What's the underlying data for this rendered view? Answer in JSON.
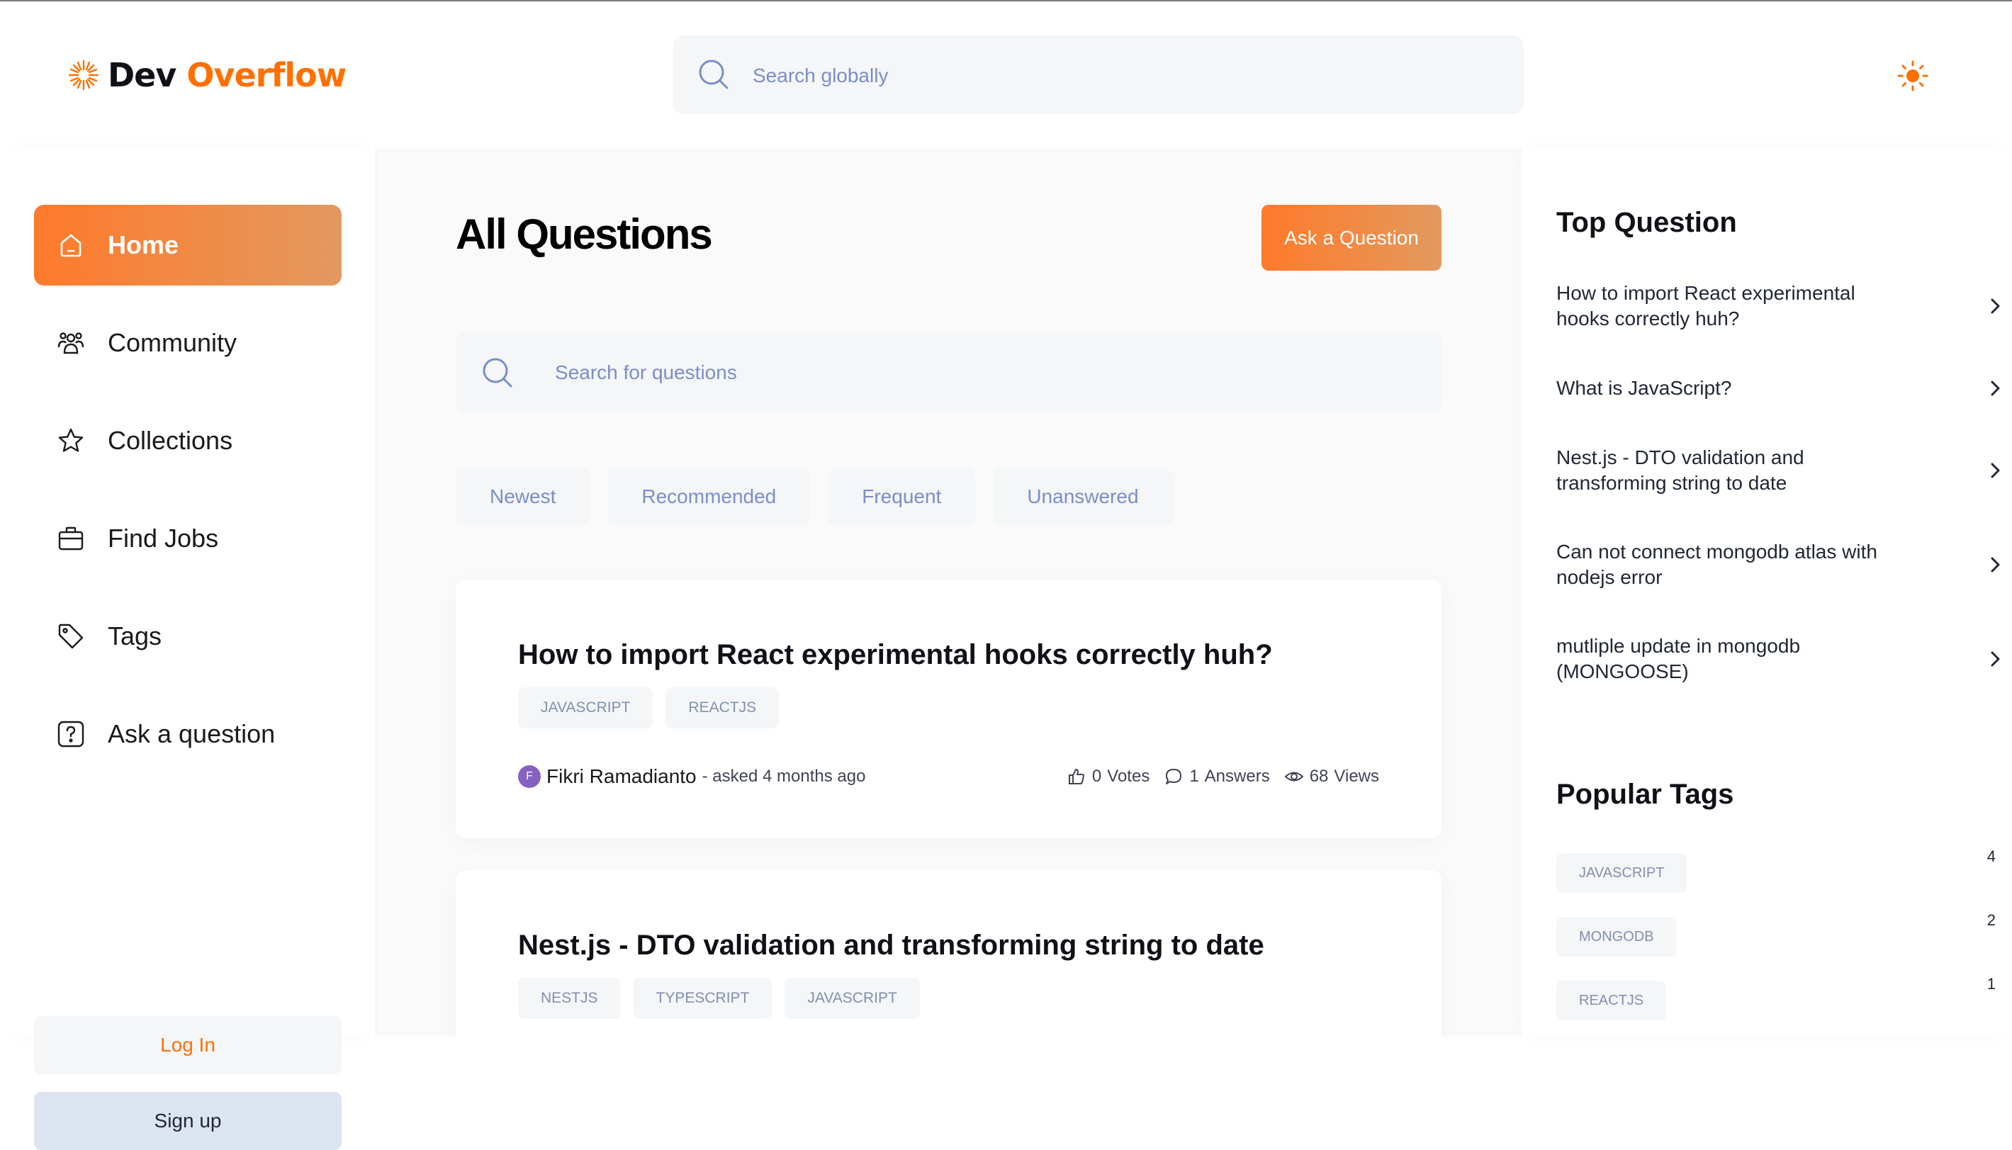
{
  "brand": {
    "part1": "Dev",
    "part2": "Overflow"
  },
  "global_search": {
    "placeholder": "Search globally"
  },
  "nav": {
    "items": [
      {
        "label": "Home",
        "icon": "home-icon"
      },
      {
        "label": "Community",
        "icon": "users-icon"
      },
      {
        "label": "Collections",
        "icon": "star-icon"
      },
      {
        "label": "Find Jobs",
        "icon": "briefcase-icon"
      },
      {
        "label": "Tags",
        "icon": "tag-icon"
      },
      {
        "label": "Ask a question",
        "icon": "question-icon"
      }
    ],
    "login_label": "Log In",
    "signup_label": "Sign up"
  },
  "main": {
    "title": "All Questions",
    "ask_button": "Ask a Question",
    "search_placeholder": "Search for questions",
    "filters": [
      "Newest",
      "Recommended",
      "Frequent",
      "Unanswered"
    ],
    "questions": [
      {
        "title": "How to import React experimental hooks correctly huh?",
        "tags": [
          "JAVASCRIPT",
          "REACTJS"
        ],
        "author_initial": "F",
        "author": "Fikri Ramadianto",
        "asked": "- asked 4 months ago",
        "votes": "0",
        "votes_label": "Votes",
        "answers": "1",
        "answers_label": "Answers",
        "views": "68",
        "views_label": "Views"
      },
      {
        "title": "Nest.js - DTO validation and transforming string to date",
        "tags": [
          "NESTJS",
          "TYPESCRIPT",
          "JAVASCRIPT"
        ]
      }
    ]
  },
  "right": {
    "top_title": "Top Question",
    "top_questions": [
      "How to import React experimental hooks correctly huh?",
      "What is JavaScript?",
      "Nest.js - DTO validation and transforming string to date",
      "Can not connect mongodb atlas with nodejs error",
      "mutliple update in mongodb (MONGOOSE)"
    ],
    "tags_title": "Popular Tags",
    "popular_tags": [
      {
        "name": "JAVASCRIPT",
        "count": "4"
      },
      {
        "name": "MONGODB",
        "count": "2"
      },
      {
        "name": "REACTJS",
        "count": "1"
      }
    ]
  },
  "colors": {
    "accent": "#ff7000",
    "gradient_start": "#ff7a2b",
    "gradient_end": "#e2995f",
    "tag_text": "#858ead",
    "placeholder": "#7b8ec8"
  }
}
